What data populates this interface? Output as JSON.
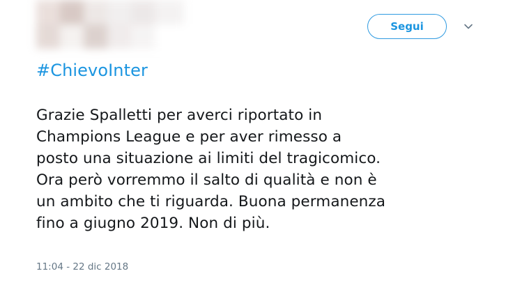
{
  "header": {
    "follow_label": "Segui"
  },
  "tweet": {
    "hashtag": "#ChievoInter",
    "text": "Grazie Spalletti per averci riportato in\nChampions League e per aver rimesso a\nposto una situazione ai limiti del tragicomico.\nOra però vorremmo il salto di qualità e non è\nun ambito che ti riguarda. Buona permanenza\nfino a giugno 2019. Non di più.",
    "timestamp": "11:04 - 22 dic 2018"
  },
  "icons": {
    "menu": "chevron-down-icon",
    "avatar": "blurred-avatar"
  },
  "colors": {
    "link": "#1b95e0",
    "text": "#14171a",
    "muted": "#657786",
    "chevron": "#657786"
  }
}
